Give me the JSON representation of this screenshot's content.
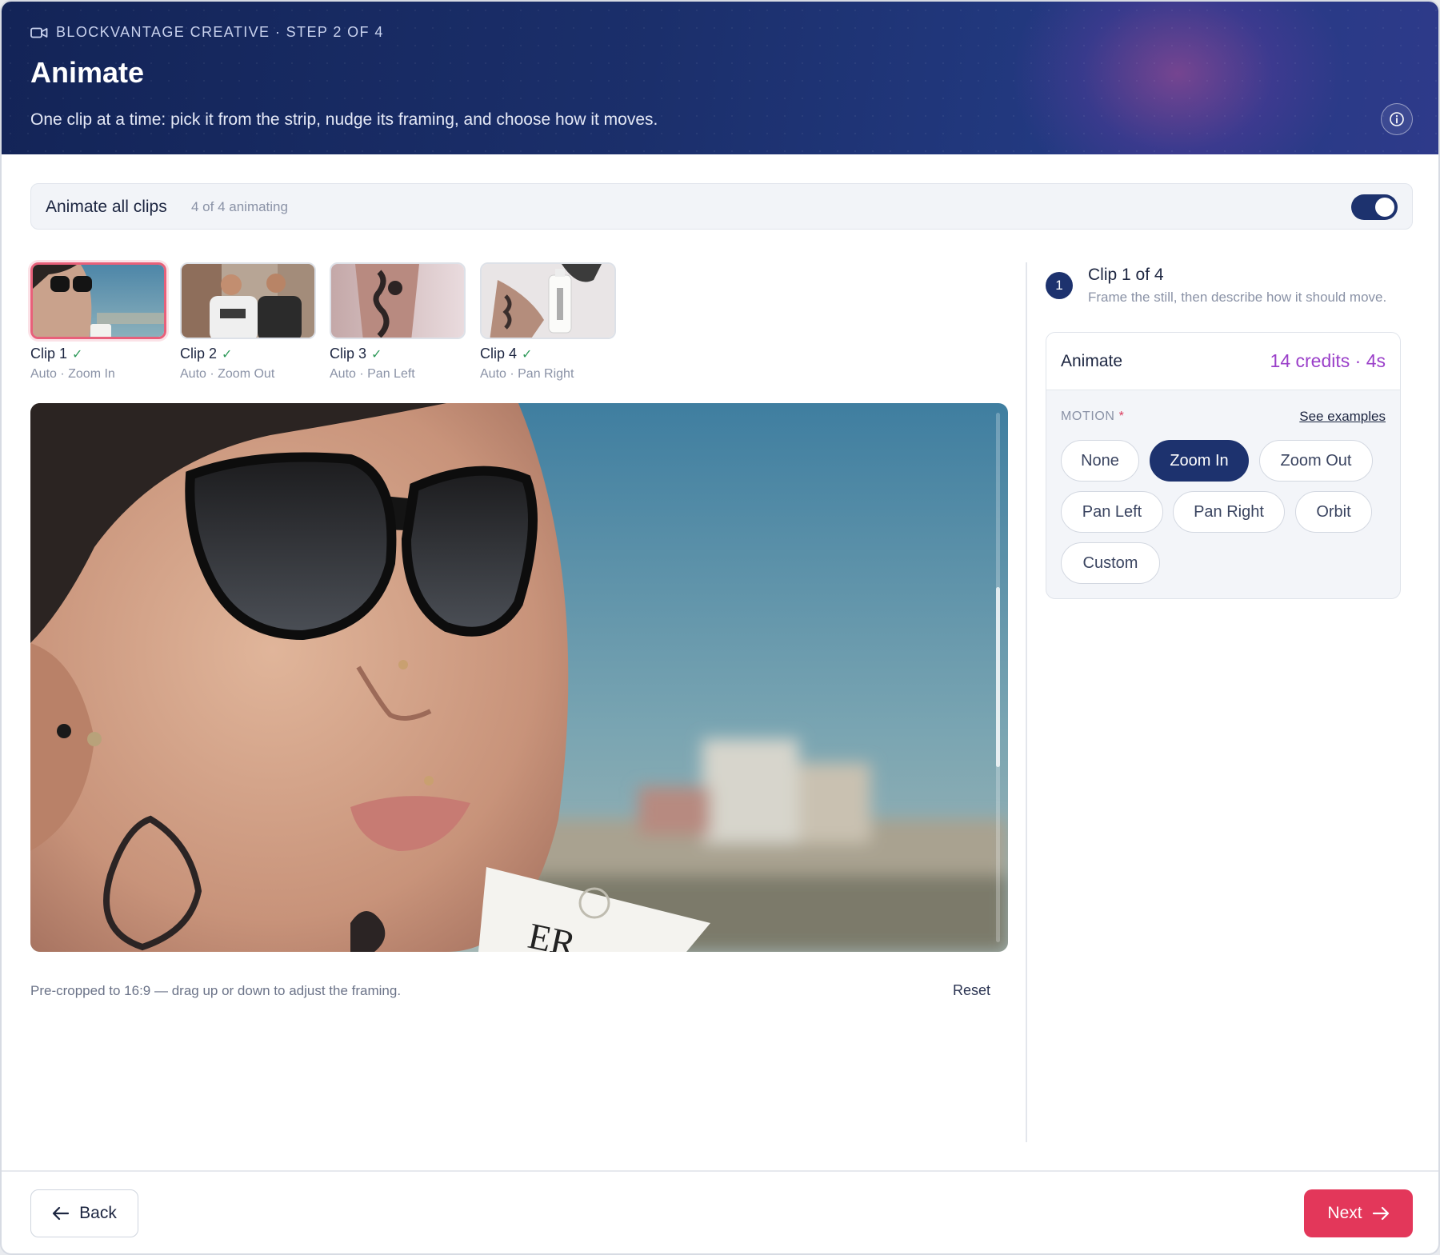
{
  "header": {
    "eyebrow": "BLOCKVANTAGE CREATIVE · STEP 2 OF 4",
    "title": "Animate",
    "subtitle": "One clip at a time: pick it from the strip, nudge its framing, and choose how it moves.",
    "info_icon": "info-icon",
    "camera_icon": "video-camera-icon"
  },
  "animate_all": {
    "label": "Animate all clips",
    "count": "4 of 4 animating",
    "enabled": true
  },
  "clips": [
    {
      "name": "Clip 1",
      "status": "Auto · Zoom In",
      "selected": true
    },
    {
      "name": "Clip 2",
      "status": "Auto · Zoom Out",
      "selected": false
    },
    {
      "name": "Clip 3",
      "status": "Auto · Pan Left",
      "selected": false
    },
    {
      "name": "Clip 4",
      "status": "Auto · Pan Right",
      "selected": false
    }
  ],
  "preview": {
    "hint": "Pre-cropped to 16:9 — drag up or down to adjust the framing.",
    "reset_label": "Reset"
  },
  "panel": {
    "step_number": "1",
    "clip_title": "Clip 1 of 4",
    "clip_desc": "Frame the still, then describe how it should move.",
    "card_title": "Animate",
    "credits": "14 credits · 4s",
    "motion_label": "MOTION",
    "required_mark": "*",
    "examples_link": "See examples",
    "motion_options": [
      "None",
      "Zoom In",
      "Zoom Out",
      "Pan Left",
      "Pan Right",
      "Orbit",
      "Custom"
    ],
    "selected_motion": "Zoom In"
  },
  "footer": {
    "back_label": "Back",
    "next_label": "Next"
  },
  "colors": {
    "brand_navy": "#1d326e",
    "accent_pink": "#e3375a",
    "credits_purple": "#9a3fc9",
    "check_green": "#2f9a5a"
  }
}
